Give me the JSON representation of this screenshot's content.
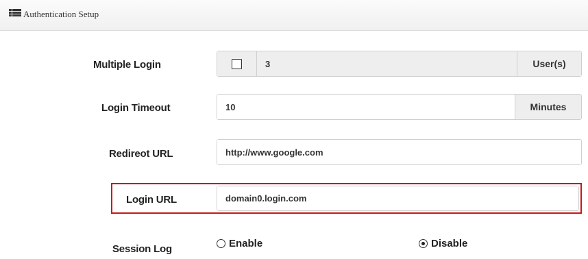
{
  "header": {
    "title": "Authentication Setup",
    "icon": "list-icon"
  },
  "multiple_login": {
    "label": "Multiple Login",
    "checked": false,
    "value": "3",
    "suffix": "User(s)"
  },
  "login_timeout": {
    "label": "Login Timeout",
    "value": "10",
    "suffix": "Minutes"
  },
  "redirect_url": {
    "label": "Redireot URL",
    "value": "http://www.google.com"
  },
  "login_url": {
    "label": "Login URL",
    "value": "domain0.login.com",
    "highlight_color": "#c81818"
  },
  "session_log": {
    "label": "Session Log",
    "options": [
      {
        "label": "Enable",
        "selected": false
      },
      {
        "label": "Disable",
        "selected": true
      }
    ]
  }
}
